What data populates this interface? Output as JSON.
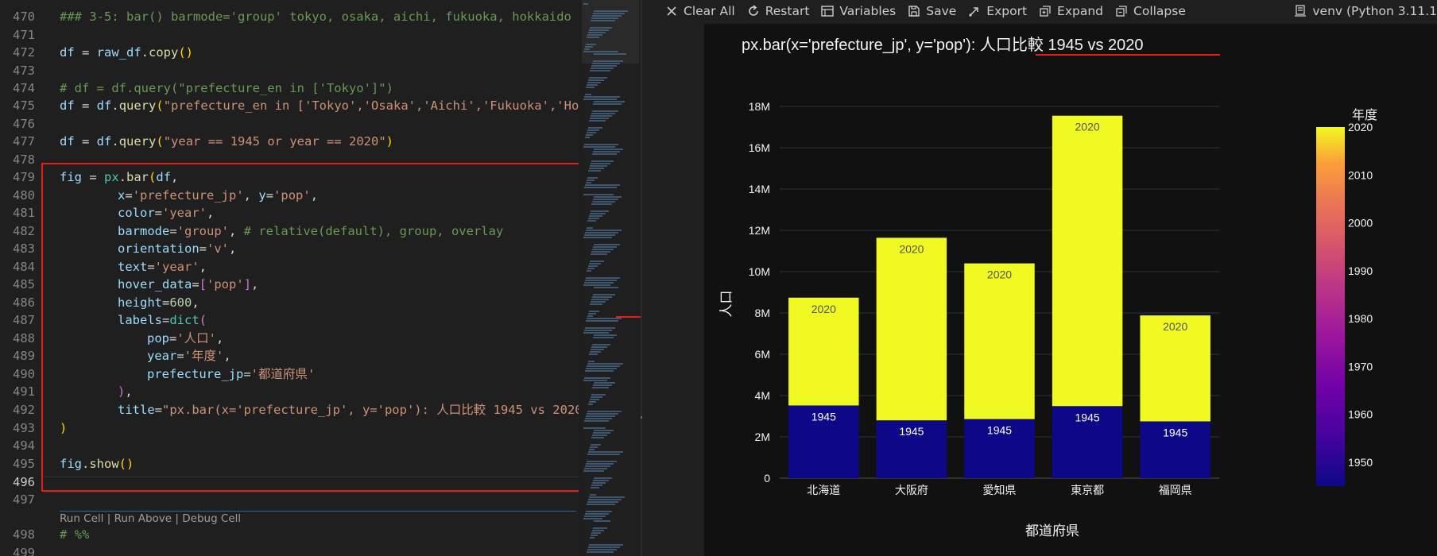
{
  "editor": {
    "lines": [
      {
        "n": "470",
        "top": 10
      },
      {
        "n": "471",
        "top": 33
      },
      {
        "n": "472",
        "top": 55
      },
      {
        "n": "473",
        "top": 78
      },
      {
        "n": "474",
        "top": 100
      },
      {
        "n": "475",
        "top": 122
      },
      {
        "n": "476",
        "top": 145
      },
      {
        "n": "477",
        "top": 167
      },
      {
        "n": "478",
        "top": 190
      },
      {
        "n": "479",
        "top": 212
      },
      {
        "n": "480",
        "top": 235
      },
      {
        "n": "481",
        "top": 257
      },
      {
        "n": "482",
        "top": 280
      },
      {
        "n": "483",
        "top": 302
      },
      {
        "n": "484",
        "top": 325
      },
      {
        "n": "485",
        "top": 347
      },
      {
        "n": "486",
        "top": 370
      },
      {
        "n": "487",
        "top": 392
      },
      {
        "n": "488",
        "top": 415
      },
      {
        "n": "489",
        "top": 437
      },
      {
        "n": "490",
        "top": 460
      },
      {
        "n": "491",
        "top": 482
      },
      {
        "n": "492",
        "top": 505
      },
      {
        "n": "493",
        "top": 528
      },
      {
        "n": "494",
        "top": 550
      },
      {
        "n": "495",
        "top": 573
      },
      {
        "n": "496",
        "top": 596
      },
      {
        "n": "497",
        "top": 618
      },
      {
        "n": "498",
        "top": 662
      },
      {
        "n": "499",
        "top": 685
      }
    ],
    "code": {
      "l470": "### 3-5: bar() barmode='group' tokyo, osaka, aichi, fukuoka, hokkaido",
      "l472_a": "df",
      "l472_b": " = ",
      "l472_c": "raw_df",
      "l472_d": ".",
      "l472_e": "copy",
      "l472_f": "()",
      "l474": "# df = df.query(\"prefecture_en in ['Tokyo']\")",
      "l475_a": "df",
      "l475_b": " = ",
      "l475_c": "df",
      "l475_d": ".",
      "l475_e": "query",
      "l475_f": "(",
      "l475_g": "\"prefecture_en in ['Tokyo','Osaka','Aichi','Fukuoka','Hok",
      "l477_a": "df",
      "l477_b": " = ",
      "l477_c": "df",
      "l477_d": ".",
      "l477_e": "query",
      "l477_f": "(",
      "l477_g": "\"year == 1945 or year == 2020\"",
      "l477_h": ")",
      "l479_a": "fig",
      "l479_b": " = ",
      "l479_c": "px",
      "l479_d": ".",
      "l479_e": "bar",
      "l479_f": "(",
      "l479_g": "df",
      "l479_h": ",",
      "l480_a": "x",
      "l480_b": "=",
      "l480_c": "'prefecture_jp'",
      "l480_d": ", ",
      "l480_e": "y",
      "l480_f": "=",
      "l480_g": "'pop'",
      "l480_h": ",",
      "l481_a": "color",
      "l481_b": "=",
      "l481_c": "'year'",
      "l481_d": ",",
      "l482_a": "barmode",
      "l482_b": "=",
      "l482_c": "'group'",
      "l482_d": ", ",
      "l482_e": "# relative(default), group, overlay",
      "l483_a": "orientation",
      "l483_b": "=",
      "l483_c": "'v'",
      "l483_d": ",",
      "l484_a": "text",
      "l484_b": "=",
      "l484_c": "'year'",
      "l484_d": ",",
      "l485_a": "hover_data",
      "l485_b": "=",
      "l485_c": "[",
      "l485_d": "'pop'",
      "l485_e": "]",
      "l485_f": ",",
      "l486_a": "height",
      "l486_b": "=",
      "l486_c": "600",
      "l486_d": ",",
      "l487_a": "labels",
      "l487_b": "=",
      "l487_c": "dict",
      "l487_d": "(",
      "l488_a": "pop",
      "l488_b": "=",
      "l488_c": "'人口'",
      "l488_d": ",",
      "l489_a": "year",
      "l489_b": "=",
      "l489_c": "'年度'",
      "l489_d": ",",
      "l490_a": "prefecture_jp",
      "l490_b": "=",
      "l490_c": "'都道府県'",
      "l491_a": ")",
      "l491_b": ",",
      "l492_a": "title",
      "l492_b": "=",
      "l492_c": "\"px.bar(x='prefecture_jp', y='pop'): 人口比較 1945 vs 2020",
      "l493": ")",
      "l495_a": "fig",
      "l495_b": ".",
      "l495_c": "show",
      "l495_d": "()",
      "l498": "# %%"
    },
    "cell_actions": {
      "run_cell": "Run Cell",
      "sep1": " | ",
      "run_above": "Run Above",
      "sep2": " | ",
      "debug_cell": "Debug Cell"
    }
  },
  "toolbar": {
    "clear_all": "Clear All",
    "restart": "Restart",
    "variables": "Variables",
    "save": "Save",
    "export": "Export",
    "expand": "Expand",
    "collapse": "Collapse",
    "kernel": "venv (Python 3.11.1"
  },
  "icons": {
    "clear_all": "close-icon",
    "restart": "restart-icon",
    "variables": "variables-icon",
    "save": "save-icon",
    "export": "export-icon",
    "expand": "expand-icon",
    "collapse": "collapse-icon",
    "kernel": "kernel-icon"
  },
  "colors": {
    "highlight_red": "#e0201b",
    "bar_1945": "#0d0887",
    "bar_2020": "#f0f921",
    "plot_bg": "#111111"
  },
  "chart_data": {
    "type": "bar",
    "title_prefix": "px.bar(x='prefecture_jp', y='pop'): ",
    "title_highlight": "人口比較 1945 vs 2020",
    "xlabel": "都道府県",
    "ylabel": "人口",
    "categories": [
      "北海道",
      "大阪府",
      "愛知県",
      "東京都",
      "福岡県"
    ],
    "barmode": "relative",
    "series": [
      {
        "name": "1945",
        "values": [
          3.52,
          2.8,
          2.86,
          3.49,
          2.75
        ],
        "color": "#0d0887",
        "text": "1945"
      },
      {
        "name": "2020",
        "values": [
          5.22,
          8.84,
          7.54,
          14.06,
          5.13
        ],
        "color": "#f0f921",
        "text": "2020"
      }
    ],
    "ylim": [
      0,
      18
    ],
    "y_ticks": [
      "0",
      "2M",
      "4M",
      "6M",
      "8M",
      "10M",
      "12M",
      "14M",
      "16M",
      "18M"
    ],
    "grid": true,
    "colorbar": {
      "title": "年度",
      "ticks": [
        "1950",
        "1960",
        "1970",
        "1980",
        "1990",
        "2000",
        "2010",
        "2020"
      ],
      "range": [
        1945,
        2020
      ]
    }
  }
}
